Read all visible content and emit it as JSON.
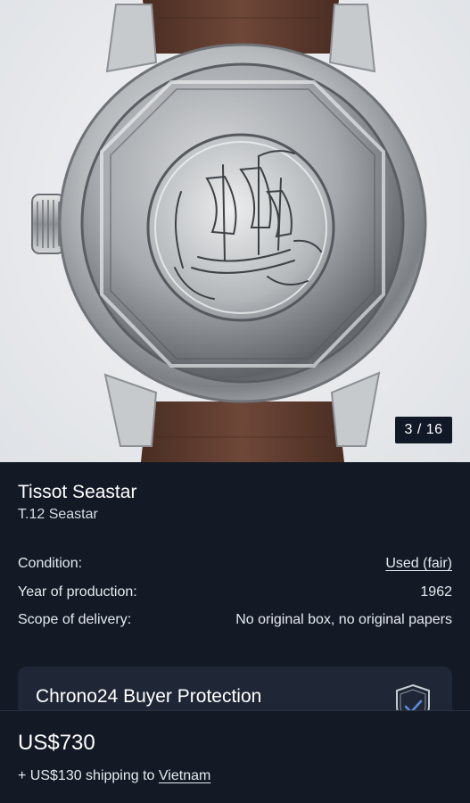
{
  "gallery": {
    "counter": "3 / 16"
  },
  "product": {
    "title": "Tissot Seastar",
    "subtitle": "T.12 Seastar"
  },
  "specs": [
    {
      "label": "Condition:",
      "value": "Used (fair)"
    },
    {
      "label": "Year of production:",
      "value": "1962"
    },
    {
      "label": "Scope of delivery:",
      "value": "No original box, no original papers"
    }
  ],
  "buyer_protection": {
    "title": "Chrono24 Buyer Protection"
  },
  "pricing": {
    "price": "US$730",
    "shipping_prefix": "+ US$130 shipping to",
    "shipping_destination": "Vietnam"
  },
  "colors": {
    "background": "#131a26",
    "card": "#1f2736",
    "text": "#ffffff"
  },
  "icons": {
    "protection": "shield-check-icon"
  }
}
